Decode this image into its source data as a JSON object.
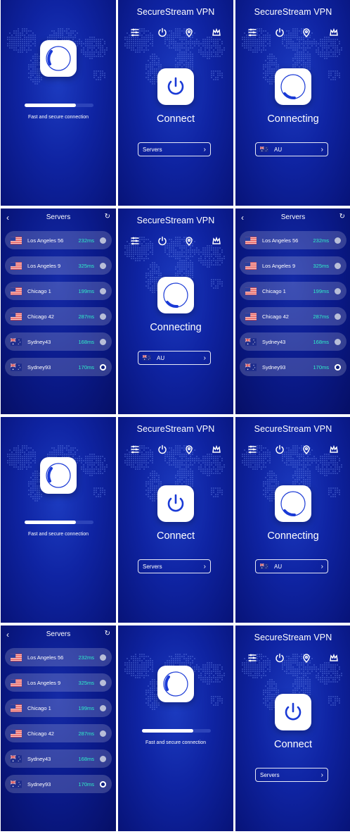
{
  "app": {
    "title": "SecureStream VPN"
  },
  "splash": {
    "caption": "Fast and secure connection",
    "progress": 0.74
  },
  "home": {
    "connect_label": "Connect",
    "connecting_label": "Connecting",
    "servers_button": "Servers",
    "selected_country": "AU",
    "nav_icons": [
      "sliders-icon",
      "power-icon",
      "location-pin-icon",
      "crown-icon"
    ]
  },
  "servers": {
    "title": "Servers",
    "items": [
      {
        "name": "Los Angeles 56",
        "ping": "232ms",
        "flag": "us",
        "selected": false
      },
      {
        "name": "Los Angeles 9",
        "ping": "325ms",
        "flag": "us",
        "selected": false
      },
      {
        "name": "Chicago 1",
        "ping": "199ms",
        "flag": "us",
        "selected": false
      },
      {
        "name": "Chicago 42",
        "ping": "287ms",
        "flag": "us",
        "selected": false
      },
      {
        "name": "Sydney43",
        "ping": "168ms",
        "flag": "au",
        "selected": false
      },
      {
        "name": "Sydney93",
        "ping": "170ms",
        "flag": "au",
        "selected": true
      }
    ]
  },
  "colors": {
    "accent": "#1a3ad6",
    "ping": "#2ef0c8",
    "background": "#0f24a3"
  }
}
